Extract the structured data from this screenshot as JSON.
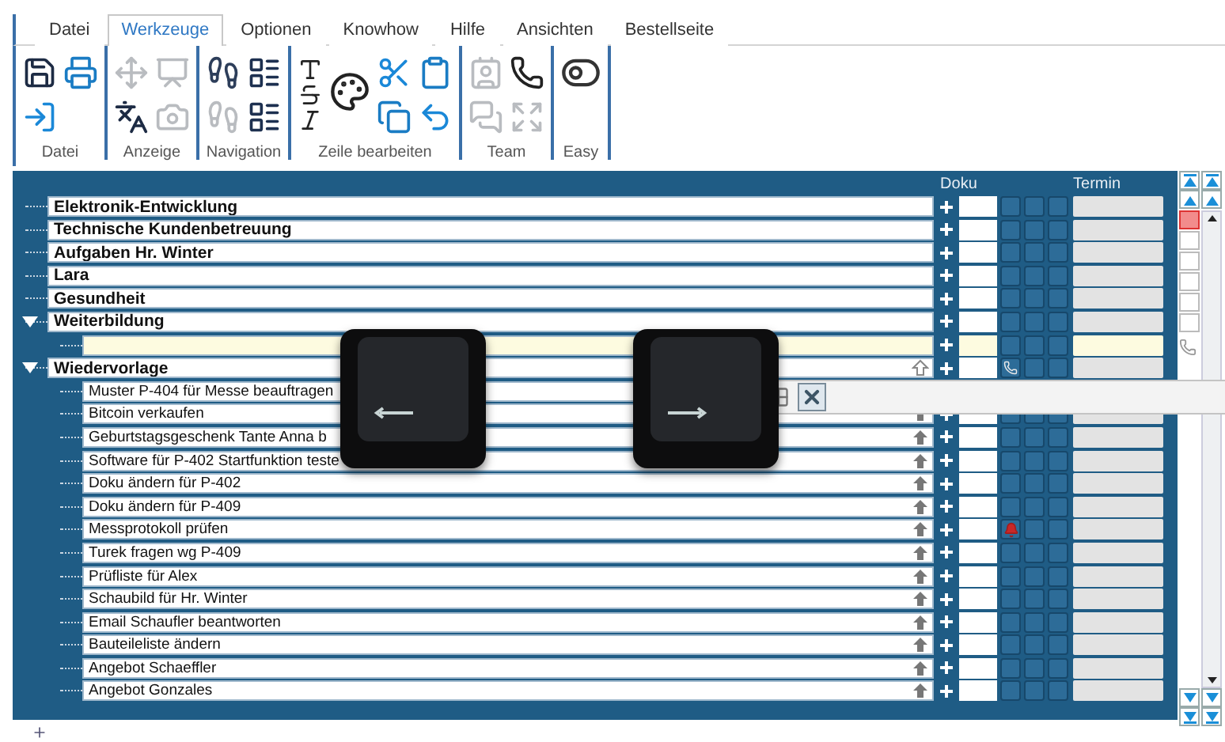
{
  "tabs": [
    {
      "label": "Datei",
      "selected": false
    },
    {
      "label": "Werkzeuge",
      "selected": true
    },
    {
      "label": "Optionen",
      "selected": false
    },
    {
      "label": "Knowhow",
      "selected": false
    },
    {
      "label": "Hilfe",
      "selected": false
    },
    {
      "label": "Ansichten",
      "selected": false
    },
    {
      "label": "Bestellseite",
      "selected": false
    }
  ],
  "ribbon_groups": [
    {
      "label": "Datei"
    },
    {
      "label": "Anzeige"
    },
    {
      "label": "Navigation"
    },
    {
      "label": "Zeile bearbeiten"
    },
    {
      "label": "Team"
    },
    {
      "label": "Easy"
    }
  ],
  "columns": {
    "doku": "Doku",
    "termin": "Termin"
  },
  "tree": [
    {
      "label": "Elektronik-Entwicklung",
      "expanded": false
    },
    {
      "label": "Technische Kundenbetreuung",
      "expanded": false
    },
    {
      "label": "Aufgaben Hr. Winter",
      "expanded": false
    },
    {
      "label": "Lara",
      "expanded": false
    },
    {
      "label": "Gesundheit",
      "expanded": false
    },
    {
      "label": "Weiterbildung",
      "expanded": true,
      "children": [
        {
          "kind": "edit"
        }
      ]
    },
    {
      "label": "Wiedervorlage",
      "expanded": true,
      "up_arrow": true,
      "phone": true,
      "children": [
        {
          "kind": "task",
          "label": "Muster P-404 für Messe beauftragen"
        },
        {
          "kind": "task",
          "label": "Bitcoin verkaufen",
          "up_arrow": true
        },
        {
          "kind": "task",
          "label": "Geburtstagsgeschenk Tante Anna b",
          "up_arrow": true
        },
        {
          "kind": "task",
          "label": "Software für P-402 Startfunktion teste",
          "up_arrow": true
        },
        {
          "kind": "task",
          "label": "Doku ändern für P-402",
          "up_arrow": true
        },
        {
          "kind": "task",
          "label": "Doku ändern für P-409",
          "up_arrow": true
        },
        {
          "kind": "task",
          "label": "Messprotokoll prüfen",
          "up_arrow": true,
          "alarm": true
        },
        {
          "kind": "task",
          "label": "Turek fragen wg P-409",
          "up_arrow": true
        },
        {
          "kind": "task",
          "label": "Prüfliste für Alex",
          "up_arrow": true
        },
        {
          "kind": "task",
          "label": "Schaubild für Hr. Winter",
          "up_arrow": true
        },
        {
          "kind": "task",
          "label": "Email Schaufler beantworten",
          "up_arrow": true
        },
        {
          "kind": "task",
          "label": "Bauteileliste ändern",
          "up_arrow": true
        },
        {
          "kind": "task",
          "label": "Angebot Schaeffler",
          "up_arrow": true
        },
        {
          "kind": "task",
          "label": "Angebot Gonzales",
          "up_arrow": true
        }
      ]
    }
  ]
}
